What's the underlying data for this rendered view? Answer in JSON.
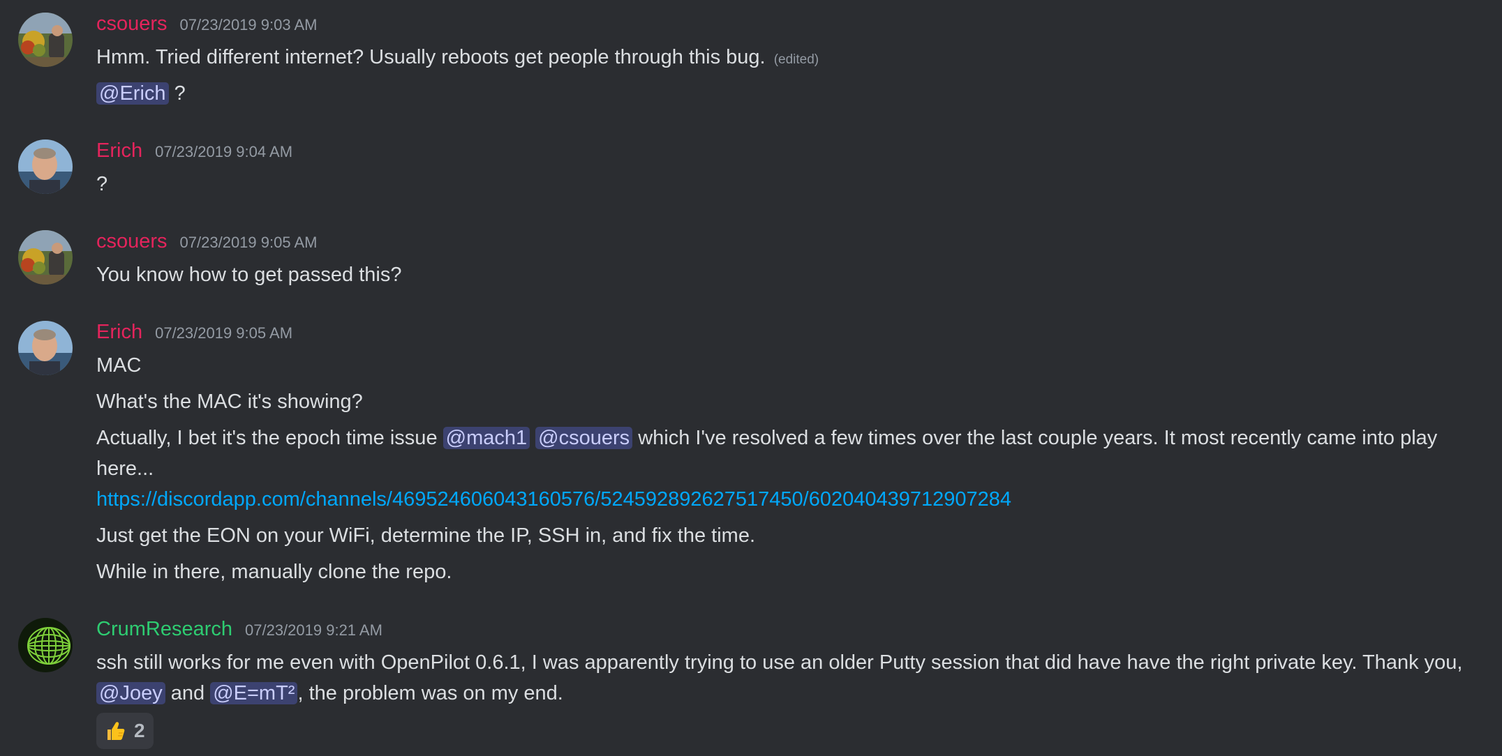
{
  "messages": [
    {
      "author": "csouers",
      "timestamp": "07/23/2019 9:03 AM",
      "lines": [
        "Hmm. Tried different internet? Usually reboots get people through this bug."
      ],
      "edited": "(edited)",
      "mention_line": {
        "mention": "@Erich",
        "suffix": " ?"
      }
    },
    {
      "author": "Erich",
      "timestamp": "07/23/2019 9:04 AM",
      "lines": [
        "?"
      ]
    },
    {
      "author": "csouers",
      "timestamp": "07/23/2019 9:05 AM",
      "lines": [
        "You know how to get passed this?"
      ]
    },
    {
      "author": "Erich",
      "timestamp": "07/23/2019 9:05 AM",
      "lines": [
        "MAC",
        "What's the MAC it's showing?"
      ],
      "epoch": {
        "prefix": "Actually, I bet it's the epoch time issue ",
        "mention1": "@mach1",
        "mention2": "@csouers",
        "suffix": " which I've resolved a few times over the last couple years.  It most recently came into play here..."
      },
      "link": "https://discordapp.com/channels/469524606043160576/524592892627517450/602040439712907284",
      "after": [
        "Just get the EON on your WiFi, determine the IP, SSH in, and fix the time.",
        "While in there, manually clone the repo."
      ]
    },
    {
      "author": "CrumResearch",
      "timestamp": "07/23/2019 9:21 AM",
      "text": {
        "prefix": "ssh still works for me even with OpenPilot 0.6.1, I was apparently trying to use an older Putty session that did have have the right private key.  Thank you, ",
        "mention1": "@Joey",
        "middle": " and ",
        "mention2": "@E=mT²",
        "suffix": ", the problem was on my end."
      },
      "reaction": {
        "emoji": "thumbs-up",
        "count": "2"
      }
    }
  ],
  "colors": {
    "background": "#2b2d31",
    "username_red": "#e4245c",
    "username_green": "#2ecc71",
    "link": "#00a8fc",
    "mention_bg": "#3c4270"
  }
}
